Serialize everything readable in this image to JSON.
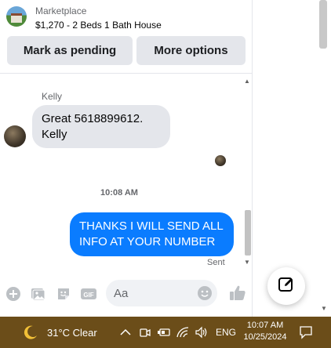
{
  "header": {
    "marketplace_label": "Marketplace",
    "listing_title": "$1,270 - 2 Beds 1 Bath House",
    "mark_pending_label": "Mark as pending",
    "more_options_label": "More options"
  },
  "messages": {
    "incoming_sender": "Kelly",
    "incoming_line1": "Great 5618899612.",
    "incoming_line2": "Kelly",
    "timestamp": "10:08 AM",
    "outgoing_line1": "THANKS I WILL SEND ALL",
    "outgoing_line2": "INFO AT YOUR NUMBER",
    "status": "Sent"
  },
  "composer": {
    "placeholder": "Aa"
  },
  "taskbar": {
    "weather": "31°C  Clear",
    "language": "ENG",
    "time": "10:07 AM",
    "date": "10/25/2024"
  },
  "colors": {
    "outgoing_bubble": "#0a7cff",
    "incoming_bubble": "#e4e6eb",
    "accent": "#0a7cff",
    "taskbar": "#6b4d19"
  },
  "icons": [
    "plus-circle-icon",
    "photo-icon",
    "sticker-icon",
    "gif-icon",
    "emoji-icon",
    "thumbs-up-icon",
    "compose-icon",
    "moon-icon",
    "chevron-up-icon",
    "meet-icon",
    "battery-icon",
    "wifi-icon",
    "volume-icon",
    "notification-icon"
  ]
}
